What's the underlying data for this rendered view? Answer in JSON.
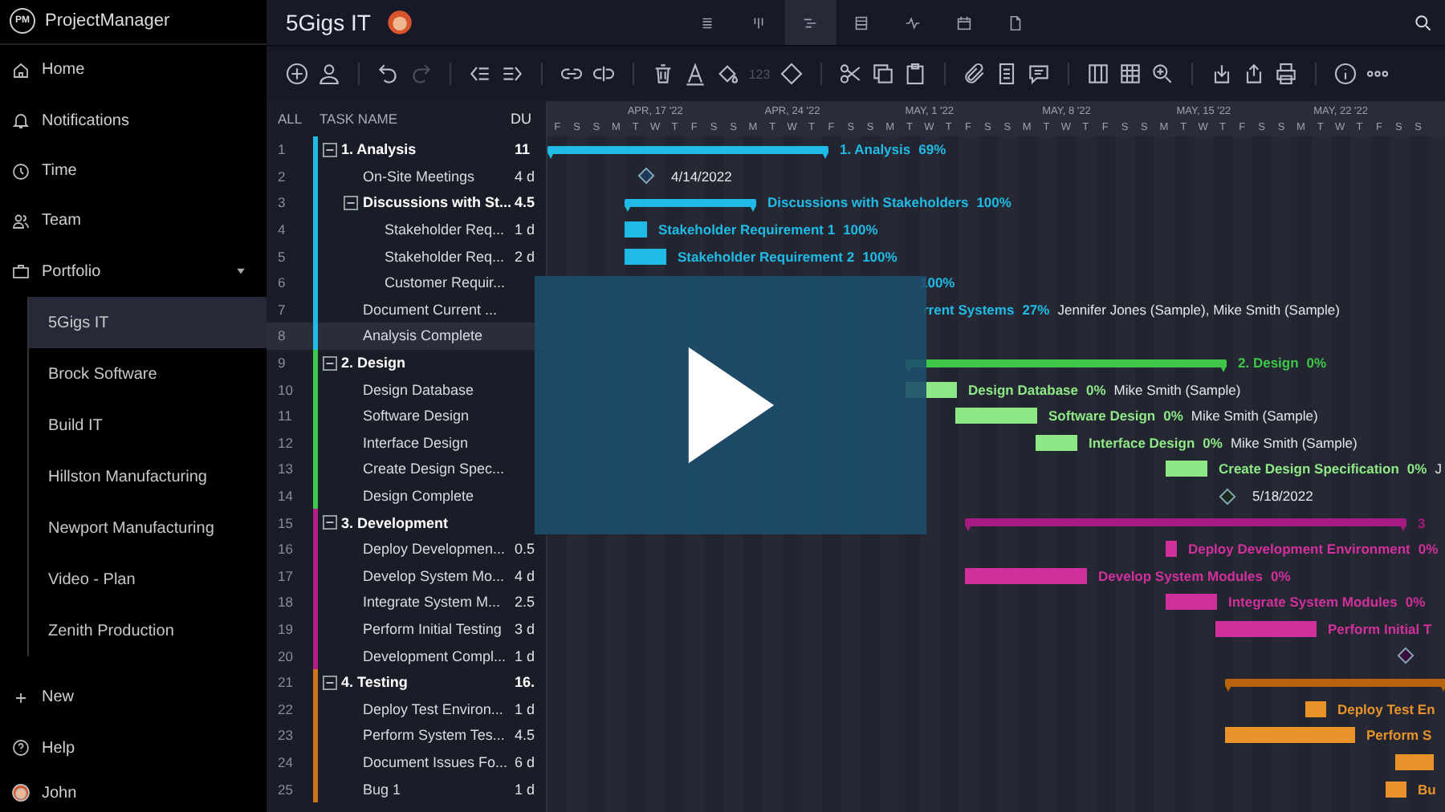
{
  "app": {
    "name": "ProjectManager",
    "logo": "PM"
  },
  "sidebar": {
    "items": [
      {
        "label": "Home"
      },
      {
        "label": "Notifications"
      },
      {
        "label": "Time"
      },
      {
        "label": "Team"
      }
    ],
    "portfolio": {
      "label": "Portfolio",
      "expanded": true,
      "children": [
        {
          "label": "5Gigs IT",
          "selected": true
        },
        {
          "label": "Brock Software",
          "selected": false
        },
        {
          "label": "Build IT",
          "selected": false
        },
        {
          "label": "Hillston Manufacturing",
          "selected": false
        },
        {
          "label": "Newport Manufacturing",
          "selected": false
        },
        {
          "label": "Video - Plan",
          "selected": false
        },
        {
          "label": "Zenith Production",
          "selected": false
        }
      ]
    },
    "bottom": [
      {
        "label": "New"
      },
      {
        "label": "Help"
      }
    ],
    "user": {
      "name": "John"
    }
  },
  "header": {
    "title": "5Gigs IT",
    "views": [
      {
        "selected": false
      },
      {
        "selected": false
      },
      {
        "selected": true
      },
      {
        "selected": false
      },
      {
        "selected": false
      },
      {
        "selected": false
      },
      {
        "selected": false
      }
    ]
  },
  "toolbar": {
    "number_label": "123"
  },
  "table": {
    "columns": [
      "ALL",
      "TASK NAME",
      "DU"
    ],
    "rows": [
      {
        "num": "1",
        "name": "1. Analysis",
        "duration": "11",
        "selected": false,
        "expanded": true,
        "color": "#1fbbe6",
        "children": [
          {
            "num": "2",
            "name": "On-Site Meetings",
            "duration": "4 d",
            "selected": false
          },
          {
            "num": "3",
            "name": "Discussions with St...",
            "duration": "4.5",
            "selected": false,
            "expanded": true,
            "children": [
              {
                "num": "4",
                "name": "Stakeholder Req...",
                "duration": "1 d",
                "selected": false
              },
              {
                "num": "5",
                "name": "Stakeholder Req...",
                "duration": "2 d",
                "selected": false
              },
              {
                "num": "6",
                "name": "Customer Requir...",
                "selected": false
              }
            ]
          },
          {
            "num": "7",
            "name": "Document Current ...",
            "selected": false
          },
          {
            "num": "8",
            "name": "Analysis Complete",
            "selected": true
          }
        ]
      },
      {
        "num": "9",
        "name": "2. Design",
        "selected": false,
        "expanded": true,
        "color": "#3fc74a",
        "children": [
          {
            "num": "10",
            "name": "Design Database",
            "selected": false
          },
          {
            "num": "11",
            "name": "Software Design",
            "selected": false
          },
          {
            "num": "12",
            "name": "Interface Design",
            "selected": false
          },
          {
            "num": "13",
            "name": "Create Design Spec...",
            "selected": false
          },
          {
            "num": "14",
            "name": "Design Complete",
            "selected": false
          }
        ]
      },
      {
        "num": "15",
        "name": "3. Development",
        "selected": false,
        "expanded": true,
        "color": "#b01e86",
        "children": [
          {
            "num": "16",
            "name": "Deploy Developmen...",
            "duration": "0.5",
            "selected": false
          },
          {
            "num": "17",
            "name": "Develop System Mo...",
            "duration": "4 d",
            "selected": false
          },
          {
            "num": "18",
            "name": "Integrate System M...",
            "duration": "2.5",
            "selected": false
          },
          {
            "num": "19",
            "name": "Perform Initial Testing",
            "duration": "3 d",
            "selected": false
          },
          {
            "num": "20",
            "name": "Development Compl...",
            "duration": "1 d",
            "selected": false
          }
        ]
      },
      {
        "num": "21",
        "name": "4. Testing",
        "duration": "16.",
        "selected": false,
        "expanded": true,
        "color": "#c9761c",
        "children": [
          {
            "num": "22",
            "name": "Deploy Test Environ...",
            "duration": "1 d",
            "selected": false
          },
          {
            "num": "23",
            "name": "Perform System Tes...",
            "duration": "4.5",
            "selected": false
          },
          {
            "num": "24",
            "name": "Document Issues Fo...",
            "duration": "6 d",
            "selected": false
          },
          {
            "num": "25",
            "name": "Bug 1",
            "duration": "1 d",
            "selected": false
          }
        ]
      }
    ]
  },
  "gantt": {
    "weeks": [
      "APR, 17 '22",
      "APR, 24 '22",
      "MAY, 1 '22",
      "MAY, 8 '22",
      "MAY, 15 '22",
      "MAY, 22 '22"
    ],
    "days": [
      "F",
      "S",
      "S",
      "M",
      "T",
      "W",
      "T",
      "F",
      "S",
      "S",
      "M",
      "T",
      "W",
      "T",
      "F",
      "S",
      "S",
      "M",
      "T",
      "W",
      "T",
      "F",
      "S",
      "S",
      "M",
      "T",
      "W",
      "T",
      "F",
      "S",
      "S",
      "M",
      "T",
      "W",
      "T",
      "F",
      "S",
      "S",
      "M",
      "T",
      "W",
      "T",
      "F",
      "S",
      "S"
    ],
    "rows": [
      {
        "kind": "summary",
        "color": "#1fbbe6",
        "label": "1. Analysis",
        "percent": "69%"
      },
      {
        "kind": "milestone",
        "color": "#1c3a55",
        "label": "4/14/2022"
      },
      {
        "kind": "summary",
        "color": "#1fbbe6",
        "label": "Discussions with Stakeholders",
        "percent": "100%"
      },
      {
        "kind": "task",
        "color": "#1fbbe6",
        "label": "Stakeholder Requirement 1",
        "percent": "100%"
      },
      {
        "kind": "task",
        "color": "#1fbbe6",
        "label": "Stakeholder Requirement 2",
        "percent": "100%"
      },
      {
        "kind": "text",
        "color": "#1fbbe6",
        "percent": "100%"
      },
      {
        "kind": "text",
        "color": "#1fbbe6",
        "label": "rrent Systems",
        "percent": "27%",
        "resources": "Jennifer Jones (Sample), Mike Smith (Sample)"
      },
      {},
      {
        "kind": "summary",
        "color": "#3fc74a",
        "label": "2. Design",
        "percent": "0%"
      },
      {
        "kind": "task",
        "color": "#8ee886",
        "label": "Design Database",
        "percent": "0%",
        "resources": "Mike Smith (Sample)"
      },
      {
        "kind": "task",
        "color": "#8ee886",
        "label": "Software Design",
        "percent": "0%",
        "resources": "Mike Smith (Sample)"
      },
      {
        "kind": "task",
        "color": "#8ee886",
        "label": "Interface Design",
        "percent": "0%",
        "resources": "Mike Smith (Sample)"
      },
      {
        "kind": "task",
        "color": "#8ee886",
        "label": "Create Design Specification",
        "percent": "0%",
        "resources": "J"
      },
      {
        "kind": "milestone",
        "color": "#1a2a1c",
        "label": "5/18/2022"
      },
      {
        "kind": "summary",
        "color": "#a61a82",
        "label": "3"
      },
      {
        "kind": "task",
        "color": "#d1309c",
        "label": "Deploy Development Environment",
        "percent": "0%"
      },
      {
        "kind": "task",
        "color": "#d1309c",
        "label": "Develop System Modules",
        "percent": "0%"
      },
      {
        "kind": "task",
        "color": "#d1309c",
        "label": "Integrate System Modules",
        "percent": "0%"
      },
      {
        "kind": "task",
        "color": "#d1309c",
        "label": "Perform Initial T"
      },
      {
        "kind": "milestone",
        "color": "#3a0f3a"
      },
      {
        "kind": "summary",
        "color": "#b8640f"
      },
      {
        "kind": "task",
        "color": "#e8922a",
        "label": "Deploy Test En"
      },
      {
        "kind": "task",
        "color": "#e8922a",
        "label": "Perform S"
      },
      {
        "kind": "task",
        "color": "#e8922a"
      },
      {
        "kind": "task",
        "color": "#e8922a",
        "label": "Bu"
      }
    ]
  }
}
